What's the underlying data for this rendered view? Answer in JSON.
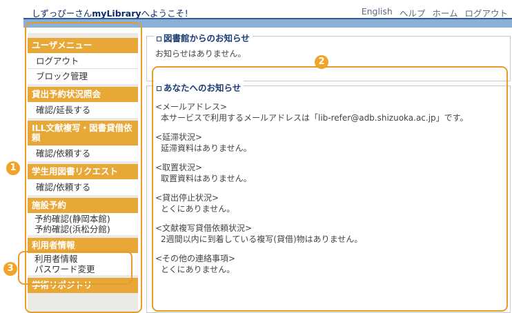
{
  "header": {
    "welcome_user": "しずっぴーさん",
    "welcome_lib": "myLibrary",
    "welcome_tail": "へようこそ！",
    "nav": [
      "English",
      "ヘルプ",
      "ホーム",
      "ログアウト"
    ]
  },
  "sidebar": {
    "sections": [
      {
        "title": "ユーザメニュー",
        "items": [
          "ログアウト",
          "ブロック管理"
        ]
      },
      {
        "title": "貸出予約状況照会",
        "items": [
          "確認/延長する"
        ]
      },
      {
        "title": "ILL文献複写・図書貸借依頼",
        "items": [
          "確認/依頼する"
        ]
      },
      {
        "title": "学生用図書リクエスト",
        "items": [
          "確認/依頼する"
        ]
      },
      {
        "title": "施設予約",
        "items": [
          "予約確認(静岡本館)",
          "予約確認(浜松分館)"
        ]
      },
      {
        "title": "利用者情報",
        "items": [
          "利用者情報",
          "パスワード変更"
        ]
      },
      {
        "title": "学術リポジトリ",
        "items": []
      }
    ]
  },
  "library_notice": {
    "title": "図書館からのお知らせ",
    "text": "お知らせはありません。"
  },
  "personal_notice": {
    "title": "あなたへのお知らせ",
    "items": [
      {
        "title": "<メールアドレス>",
        "detail": "本サービスで利用するメールアドレスは「lib-refer@adb.shizuoka.ac.jp」です。"
      },
      {
        "title": "<延滞状況>",
        "detail": "延滞資料はありません。"
      },
      {
        "title": "<取置状況>",
        "detail": "取置資料はありません。"
      },
      {
        "title": "<貸出停止状況>",
        "detail": "とくにありません。"
      },
      {
        "title": "<文献複写貸借依頼状況>",
        "detail": "2週間以内に到着している複写(貸借)物はありません。"
      },
      {
        "title": "<その他の連絡事項>",
        "detail": "とくにありません。"
      }
    ]
  },
  "annotations": [
    "1",
    "2",
    "3"
  ],
  "colors": {
    "accent": "#e8a838",
    "highlight": "#e99b2a",
    "header_bar": "#8ab0d8",
    "title_text": "#1b3c74"
  }
}
